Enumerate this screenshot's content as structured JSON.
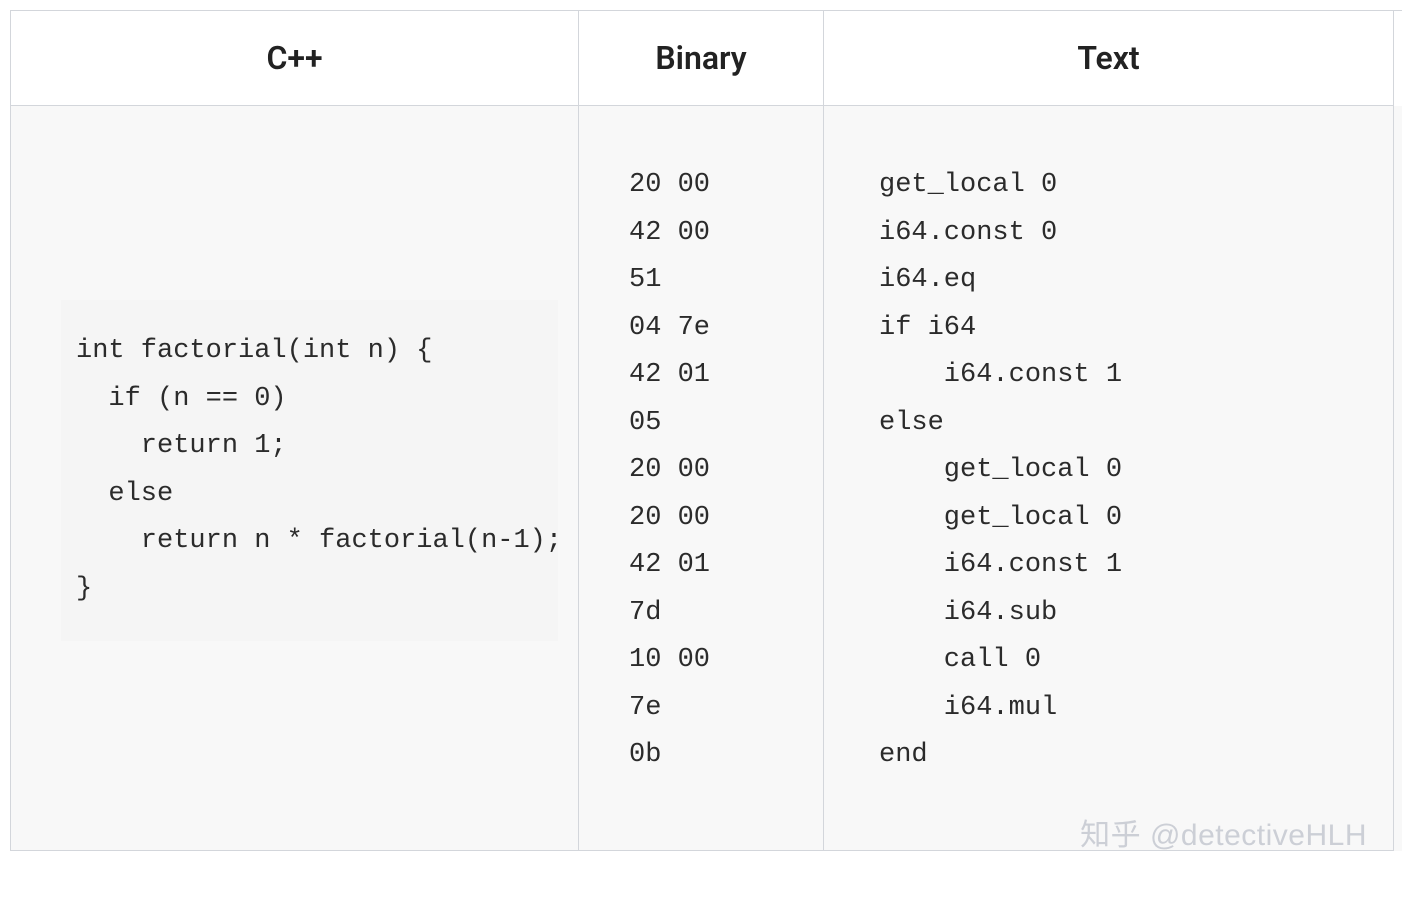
{
  "headers": {
    "cpp": "C++",
    "binary": "Binary",
    "text": "Text"
  },
  "code": {
    "cpp": "int factorial(int n) {\n  if (n == 0)\n    return 1;\n  else\n    return n * factorial(n-1);\n}",
    "binary": "20 00\n42 00\n51\n04 7e\n42 01\n05\n20 00\n20 00\n42 01\n7d\n10 00\n7e\n0b",
    "text": "get_local 0\ni64.const 0\ni64.eq\nif i64\n    i64.const 1\nelse\n    get_local 0\n    get_local 0\n    i64.const 1\n    i64.sub\n    call 0\n    i64.mul\nend"
  },
  "watermark": "知乎 @detectiveHLH"
}
